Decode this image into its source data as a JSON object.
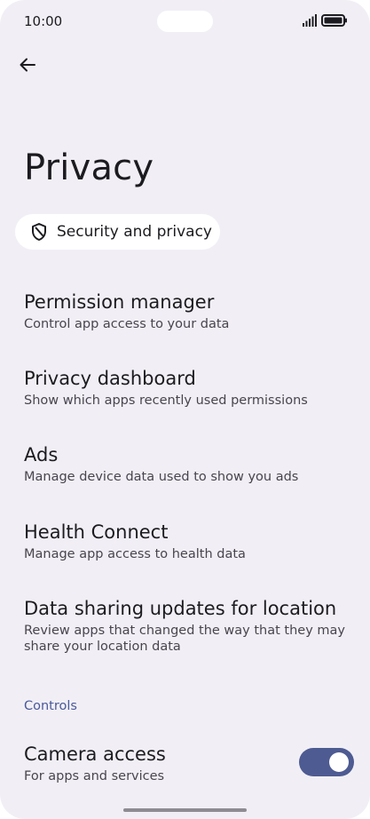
{
  "status_bar": {
    "time": "10:00"
  },
  "header": {
    "title": "Privacy"
  },
  "chip": {
    "label": "Security and privacy"
  },
  "items": [
    {
      "title": "Permission manager",
      "subtitle": "Control app access to your data"
    },
    {
      "title": "Privacy dashboard",
      "subtitle": "Show which apps recently used permissions"
    },
    {
      "title": "Ads",
      "subtitle": "Manage device data used to show you ads"
    },
    {
      "title": "Health Connect",
      "subtitle": "Manage app access to health data"
    },
    {
      "title": "Data sharing updates for location",
      "subtitle": "Review apps that changed the way that they may share your location data"
    }
  ],
  "section": {
    "label": "Controls"
  },
  "camera_access": {
    "title": "Camera access",
    "subtitle": "For apps and services",
    "enabled": true
  },
  "colors": {
    "accent": "#4e5b92",
    "background": "#f1eff5",
    "section_header": "#4a5a9a"
  },
  "icons": [
    "back-arrow-icon",
    "shield-icon",
    "signal-icon",
    "battery-icon"
  ]
}
